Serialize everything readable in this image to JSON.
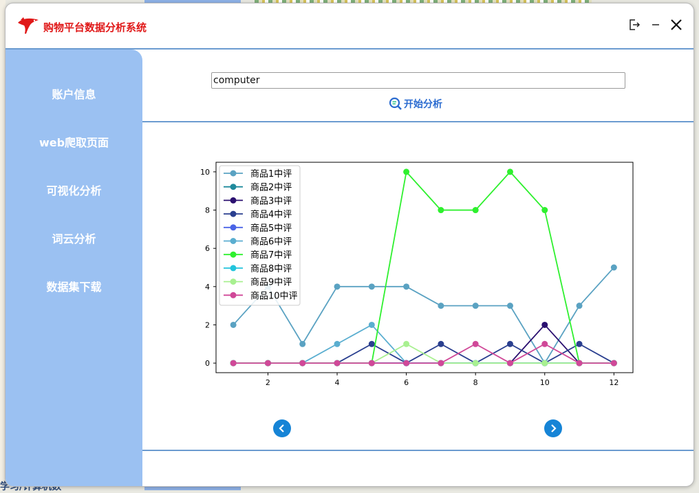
{
  "app": {
    "title": "购物平台数据分析系统"
  },
  "window_controls": {
    "logout_icon": "logout-icon",
    "minimize_icon": "minimize-icon",
    "close_icon": "close-icon"
  },
  "sidebar": {
    "items": [
      {
        "label": "账户信息"
      },
      {
        "label": "web爬取页面"
      },
      {
        "label": "可视化分析"
      },
      {
        "label": "词云分析"
      },
      {
        "label": "数据集下载"
      }
    ]
  },
  "search": {
    "value": "computer",
    "button_label": "开始分析"
  },
  "background": {
    "bottom_text": "学习/计算机数"
  },
  "colors": {
    "sidebar": "#9bc1f2",
    "accent": "#1684d6",
    "title": "#e01818"
  },
  "chart_data": {
    "type": "line",
    "title": "",
    "xlabel": "",
    "ylabel": "",
    "xlim": [
      0.5,
      12.55
    ],
    "ylim": [
      -0.5,
      10.5
    ],
    "xticks": [
      2,
      4,
      6,
      8,
      10,
      12
    ],
    "yticks": [
      0,
      2,
      4,
      6,
      8,
      10
    ],
    "legend": "upper-left",
    "x": [
      1,
      2,
      3,
      4,
      5,
      6,
      7,
      8,
      9,
      10,
      11,
      12
    ],
    "series": [
      {
        "name": "商品1中评",
        "color": "#5aa2c2",
        "values": [
          2,
          4,
          1,
          4,
          4,
          4,
          3,
          3,
          3,
          0,
          3,
          5
        ]
      },
      {
        "name": "商品2中评",
        "color": "#1f8a9c",
        "values": [
          0,
          0,
          0,
          0,
          0,
          0,
          0,
          0,
          0,
          0,
          0,
          0
        ]
      },
      {
        "name": "商品3中评",
        "color": "#2b1070",
        "values": [
          0,
          0,
          0,
          0,
          0,
          0,
          0,
          0,
          0,
          2,
          0,
          0
        ]
      },
      {
        "name": "商品4中评",
        "color": "#2a3f8f",
        "values": [
          0,
          0,
          0,
          0,
          1,
          0,
          1,
          0,
          1,
          0,
          1,
          0
        ]
      },
      {
        "name": "商品5中评",
        "color": "#4a64e6",
        "values": [
          0,
          0,
          0,
          0,
          0,
          0,
          0,
          0,
          0,
          0,
          0,
          0
        ]
      },
      {
        "name": "商品6中评",
        "color": "#5aaed0",
        "values": [
          0,
          0,
          0,
          1,
          2,
          0,
          0,
          0,
          0,
          0,
          0,
          0
        ]
      },
      {
        "name": "商品7中评",
        "color": "#2ef02e",
        "values": [
          0,
          0,
          0,
          0,
          0,
          10,
          8,
          8,
          10,
          8,
          0,
          0
        ]
      },
      {
        "name": "商品8中评",
        "color": "#22c4dc",
        "values": [
          0,
          0,
          0,
          0,
          0,
          0,
          0,
          0,
          0,
          0,
          0,
          0
        ]
      },
      {
        "name": "商品9中评",
        "color": "#a8f090",
        "values": [
          0,
          0,
          0,
          0,
          0,
          1,
          0,
          0,
          0,
          0,
          0,
          0
        ]
      },
      {
        "name": "商品10中评",
        "color": "#d04898",
        "values": [
          0,
          0,
          0,
          0,
          0,
          0,
          0,
          1,
          0,
          1,
          0,
          0
        ]
      }
    ]
  }
}
